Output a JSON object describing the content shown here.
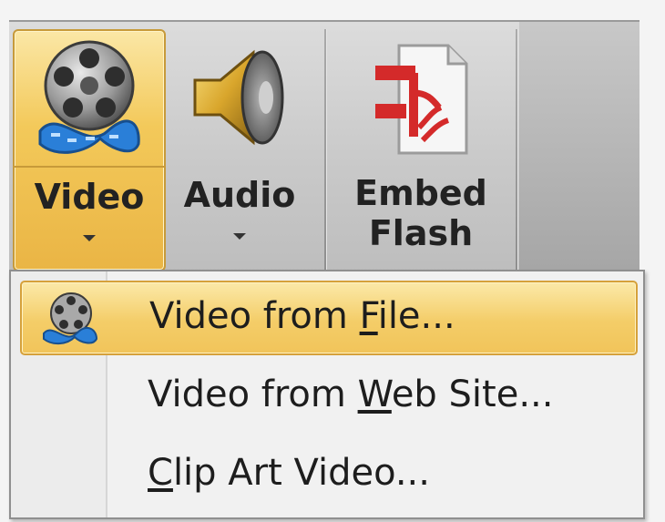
{
  "ribbon": {
    "buttons": [
      {
        "id": "video",
        "label": "Video",
        "icon": "film-reel-icon",
        "has_dropdown": true
      },
      {
        "id": "audio",
        "label": "Audio",
        "icon": "speaker-icon",
        "has_dropdown": true
      },
      {
        "id": "embed_flash",
        "label_line1": "Embed",
        "label_line2": "Flash",
        "icon": "flash-document-icon"
      }
    ]
  },
  "menu": {
    "items": [
      {
        "pre": "Video from ",
        "key": "F",
        "post": "ile...",
        "icon": "film-reel-icon",
        "highlighted": true
      },
      {
        "pre": "Video from ",
        "key": "W",
        "post": "eb Site...",
        "highlighted": false
      },
      {
        "pre": "",
        "key": "C",
        "post": "lip Art Video...",
        "highlighted": false
      }
    ]
  },
  "colors": {
    "highlight": "#f4cd68",
    "highlight_border": "#d6a13b",
    "flash_red": "#d42a2a",
    "reel_blue": "#2a7fd8"
  }
}
